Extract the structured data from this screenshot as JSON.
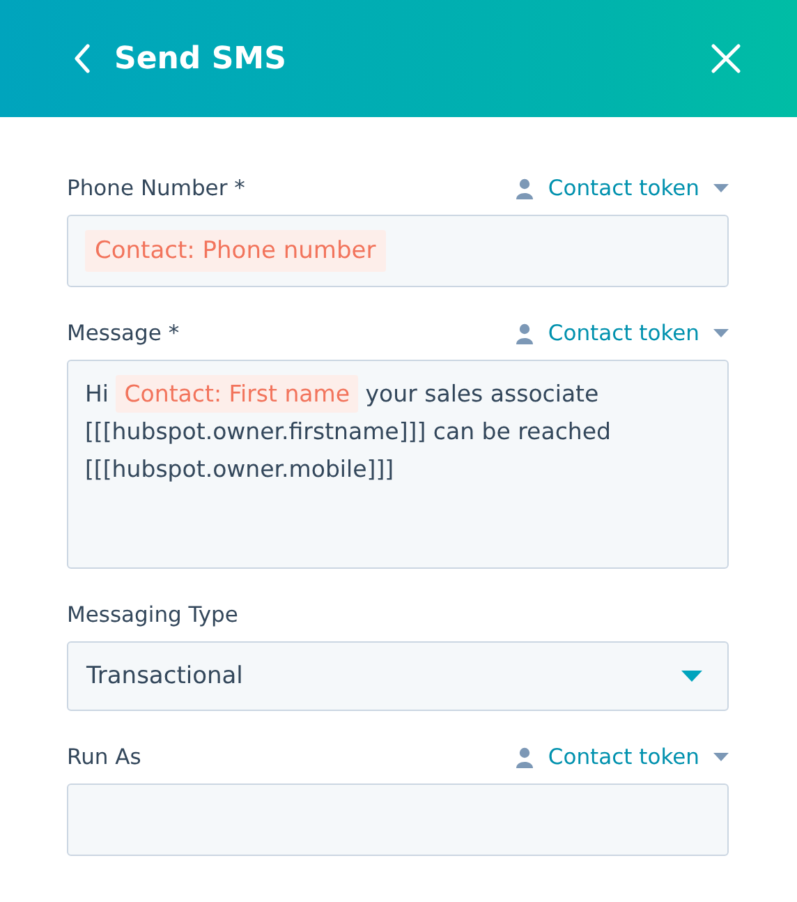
{
  "header": {
    "title": "Send SMS"
  },
  "fields": [
    {
      "kind": "tokens",
      "label": "Phone Number *",
      "token_link": "Contact token",
      "lines": [
        [
          {
            "kind": "token",
            "text": "Contact: Phone number"
          }
        ]
      ]
    },
    {
      "kind": "textarea",
      "label": "Message *",
      "token_link": "Contact token",
      "lines": [
        [
          {
            "kind": "text",
            "text": "Hi"
          },
          {
            "kind": "token",
            "text": "Contact: First name"
          },
          {
            "kind": "text",
            "text": "your sales associate"
          }
        ],
        [
          {
            "kind": "text",
            "text": "[[[hubspot.owner.firstname]]] can be reached"
          }
        ],
        [
          {
            "kind": "text",
            "text": "[[[hubspot.owner.mobile]]]"
          }
        ]
      ]
    },
    {
      "kind": "select",
      "label": "Messaging Type",
      "value": "Transactional"
    },
    {
      "kind": "tokens",
      "label": "Run As",
      "token_link": "Contact token"
    }
  ]
}
